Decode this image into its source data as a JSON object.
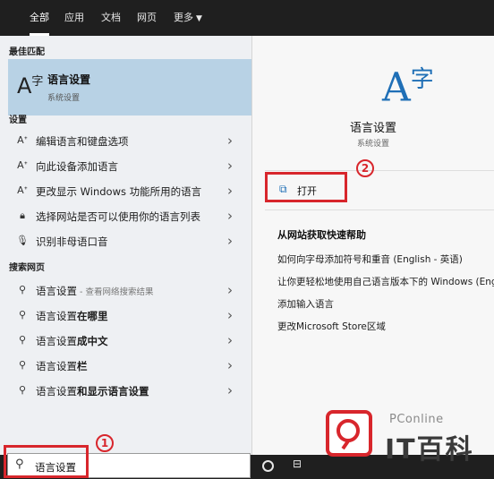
{
  "tabs": [
    {
      "label": "全部",
      "active": true
    },
    {
      "label": "应用"
    },
    {
      "label": "文档"
    },
    {
      "label": "网页"
    },
    {
      "label": "更多"
    }
  ],
  "best_match": {
    "heading": "最佳匹配",
    "title": "语言设置",
    "subtitle": "系统设置"
  },
  "settings": {
    "heading": "设置",
    "items": [
      {
        "label": "编辑语言和键盘选项",
        "icon": "language-icon"
      },
      {
        "label": "向此设备添加语言",
        "icon": "language-icon"
      },
      {
        "label": "更改显示 Windows 功能所用的语言",
        "icon": "language-icon"
      },
      {
        "label": "选择网站是否可以使用你的语言列表",
        "icon": "lock-icon"
      },
      {
        "label": "识别非母语口音",
        "icon": "microphone-icon"
      }
    ]
  },
  "web": {
    "heading": "搜索网页",
    "items": [
      {
        "prefix": "语言设置",
        "bold": "",
        "hint": " - 查看网络搜索结果"
      },
      {
        "prefix": "语言设置",
        "bold": "在哪里",
        "hint": ""
      },
      {
        "prefix": "语言设置",
        "bold": "成中文",
        "hint": ""
      },
      {
        "prefix": "语言设置",
        "bold": "栏",
        "hint": ""
      },
      {
        "prefix": "语言设置",
        "bold": "和显示语言设置",
        "hint": ""
      }
    ]
  },
  "detail": {
    "title": "语言设置",
    "subtitle": "系统设置",
    "open_label": "打开",
    "help_heading": "从网站获取快速帮助",
    "help_links": [
      "如何向字母添加符号和重音 (English - 英语)",
      "让你更轻松地使用自己语言版本下的 Windows (Engl",
      "添加输入语言",
      "更改Microsoft Store区域"
    ]
  },
  "search": {
    "value": "语言设置"
  },
  "annotations": {
    "step1": "1",
    "step2": "2",
    "accent": "#d8262c"
  },
  "watermark": {
    "brand": "PConline",
    "name": "IT百科"
  },
  "colors": {
    "topbar": "#1f1f1f",
    "left_panel": "#eef0f3",
    "highlight": "#b8d2e5",
    "right_panel": "#f7f7f7"
  }
}
